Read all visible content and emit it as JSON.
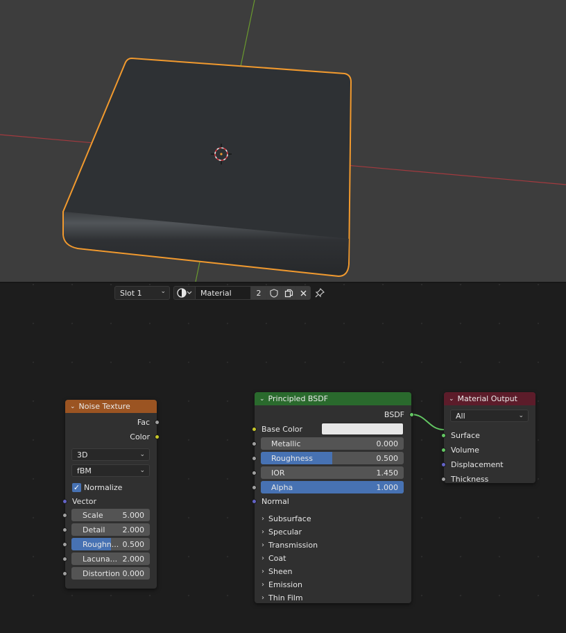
{
  "header": {
    "slot": "Slot 1",
    "material_name": "Material",
    "user_count": "2"
  },
  "icons": {
    "slot_dropdown": "chevron-down-icon",
    "material_browse": "material-sphere-icon",
    "fake_user": "shield-icon",
    "duplicate": "duplicate-icon",
    "unlink": "close-icon",
    "pin": "pin-icon"
  },
  "colors": {
    "selection_outline": "#f29a2e",
    "x_axis": "#a33a3f",
    "y_axis": "#6a9a2e",
    "noise_header": "#9b5422",
    "bsdf_header": "#2a6a2d",
    "output_header": "#5c1c2a",
    "slider_fill": "#4772b3",
    "link": "#63c763"
  },
  "nodes": {
    "noise": {
      "title": "Noise Texture",
      "out_fac": "Fac",
      "out_color": "Color",
      "dimensions": "3D",
      "type": "fBM",
      "normalize": "Normalize",
      "normalize_checked": true,
      "vector": "Vector",
      "fields": [
        {
          "label": "Scale",
          "value": "5.000",
          "fill": 0
        },
        {
          "label": "Detail",
          "value": "2.000",
          "fill": 0
        },
        {
          "label": "Roughn...",
          "value": "0.500",
          "fill": 0.5
        },
        {
          "label": "Lacuna...",
          "value": "2.000",
          "fill": 0
        },
        {
          "label": "Distortion",
          "value": "0.000",
          "fill": 0
        }
      ]
    },
    "bsdf": {
      "title": "Principled BSDF",
      "out": "BSDF",
      "base_color": "Base Color",
      "fields": [
        {
          "label": "Metallic",
          "value": "0.000",
          "fill": 0
        },
        {
          "label": "Roughness",
          "value": "0.500",
          "fill": 0.5
        },
        {
          "label": "IOR",
          "value": "1.450",
          "fill": 0
        },
        {
          "label": "Alpha",
          "value": "1.000",
          "fill": 1
        }
      ],
      "normal": "Normal",
      "panels": [
        "Subsurface",
        "Specular",
        "Transmission",
        "Coat",
        "Sheen",
        "Emission",
        "Thin Film"
      ]
    },
    "output": {
      "title": "Material Output",
      "target": "All",
      "inputs": [
        "Surface",
        "Volume",
        "Displacement",
        "Thickness"
      ]
    }
  }
}
